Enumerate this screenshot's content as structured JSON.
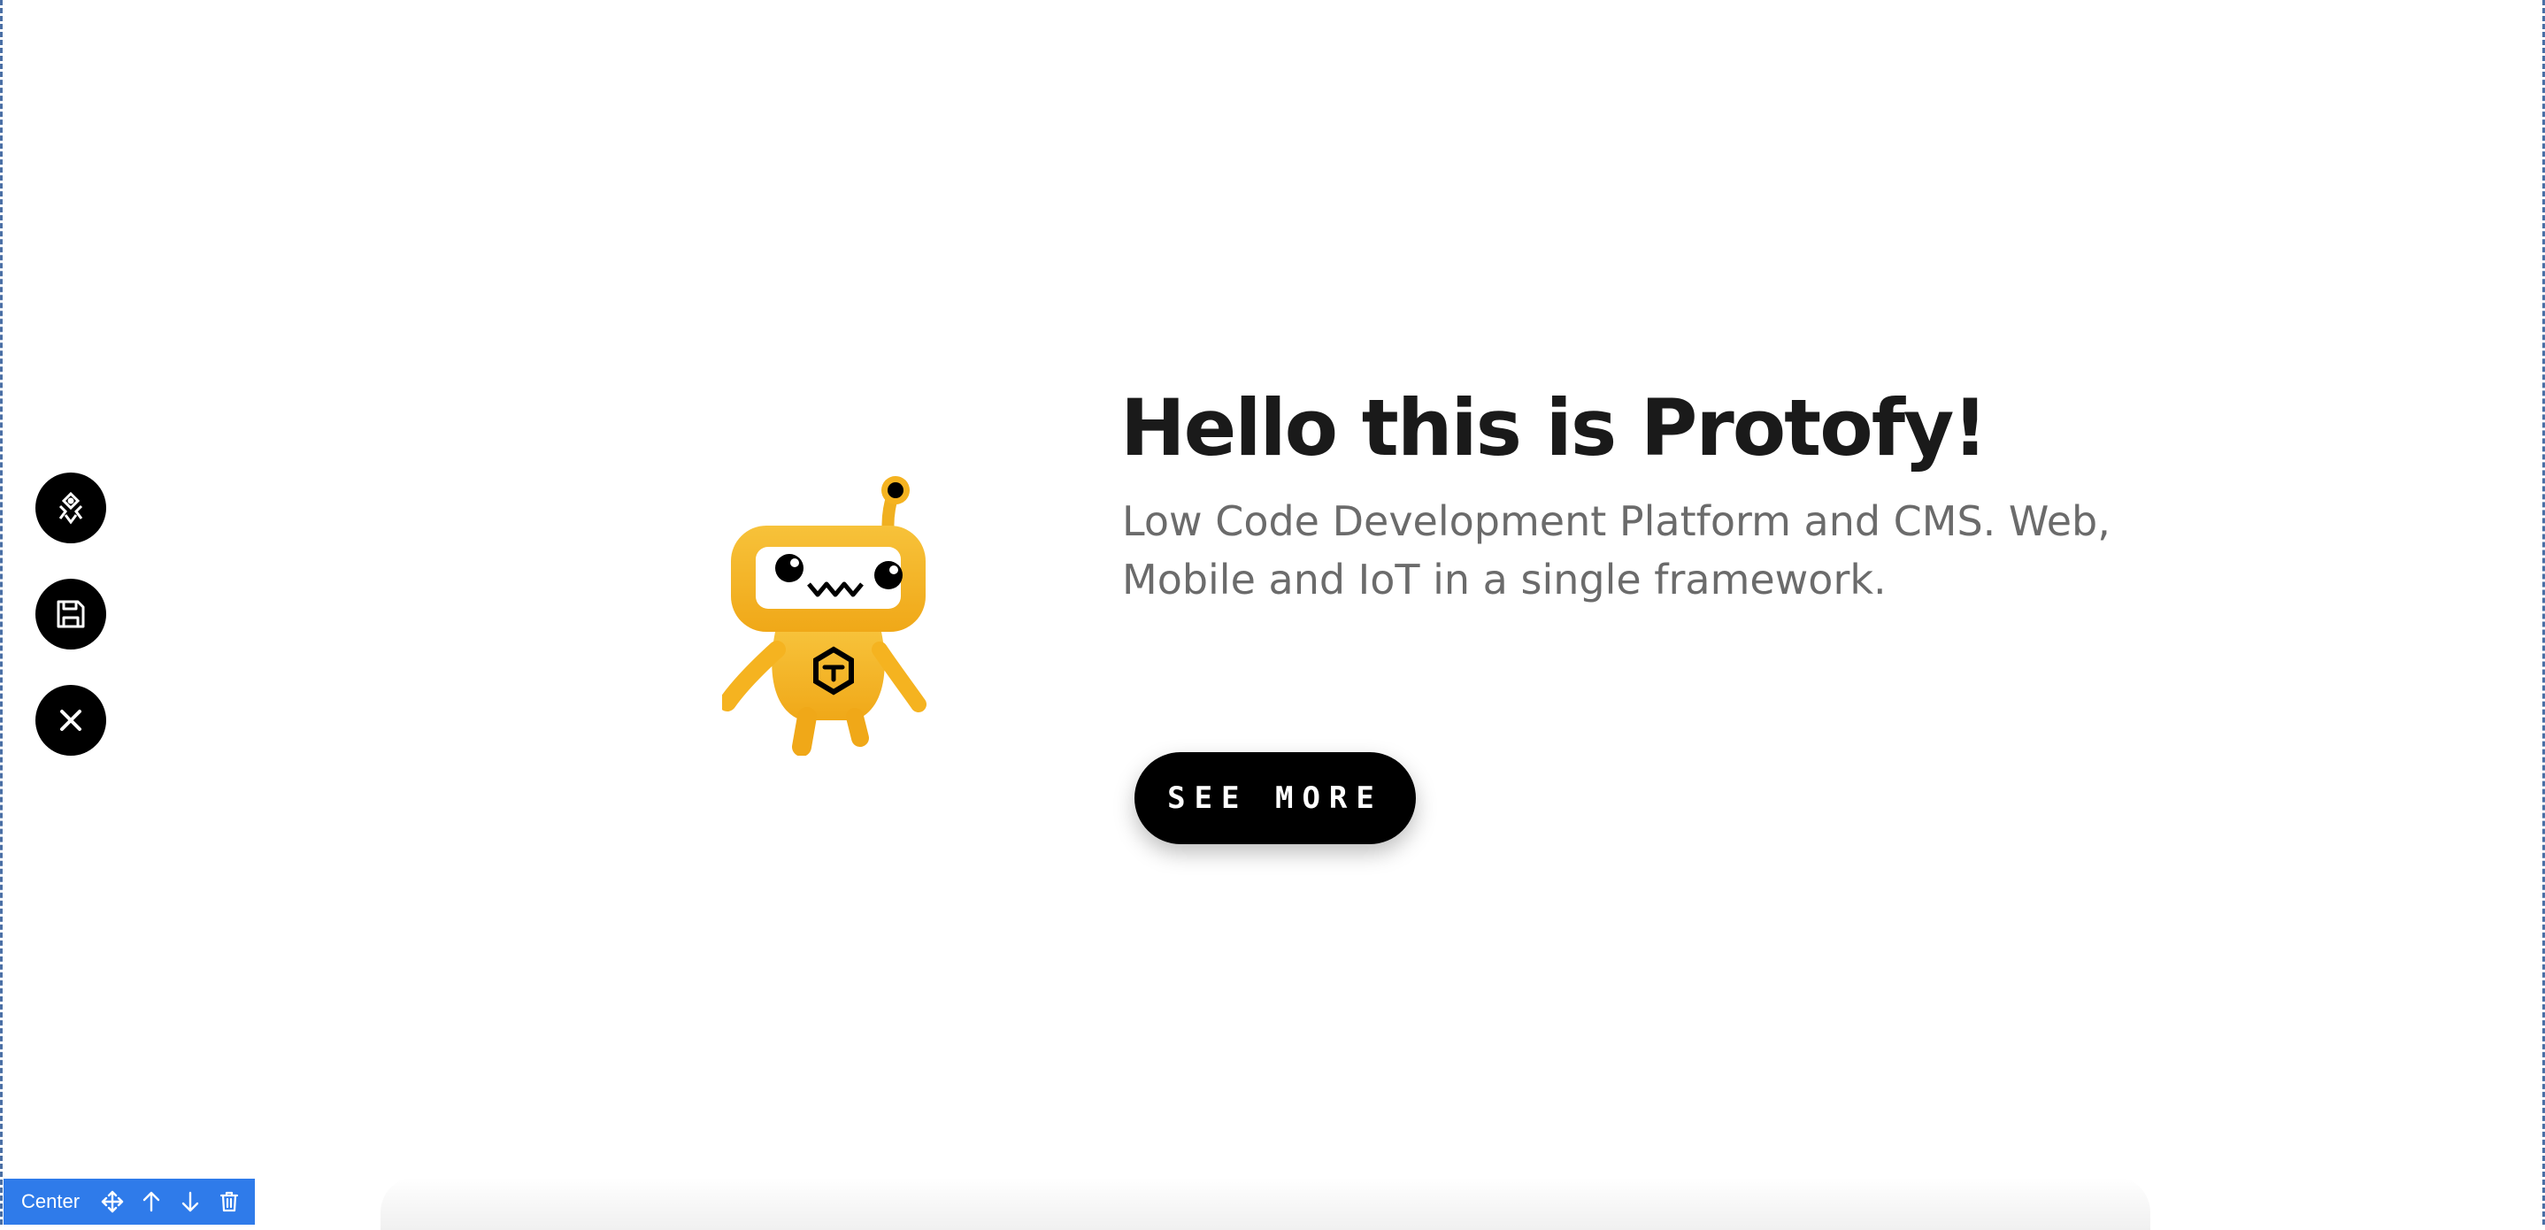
{
  "hero": {
    "title": "Hello this is Protofy!",
    "subtitle": "Low Code Development Platform and CMS. Web, Mobile and IoT in a single framework.",
    "cta_label": "SEE MORE"
  },
  "side_tools": {
    "items": [
      {
        "icon": "protofy-logo-icon"
      },
      {
        "icon": "save-icon"
      },
      {
        "icon": "close-icon"
      }
    ]
  },
  "block_toolbar": {
    "label": "Center",
    "icons": [
      "move-icon",
      "arrow-up-icon",
      "arrow-down-icon",
      "trash-icon"
    ],
    "color": "#2f7bea"
  },
  "colors": {
    "background": "#ffffff",
    "title": "#1a1a1a",
    "subtitle": "#6b6b6b",
    "button": "#000000",
    "robot": "#f5b320"
  }
}
